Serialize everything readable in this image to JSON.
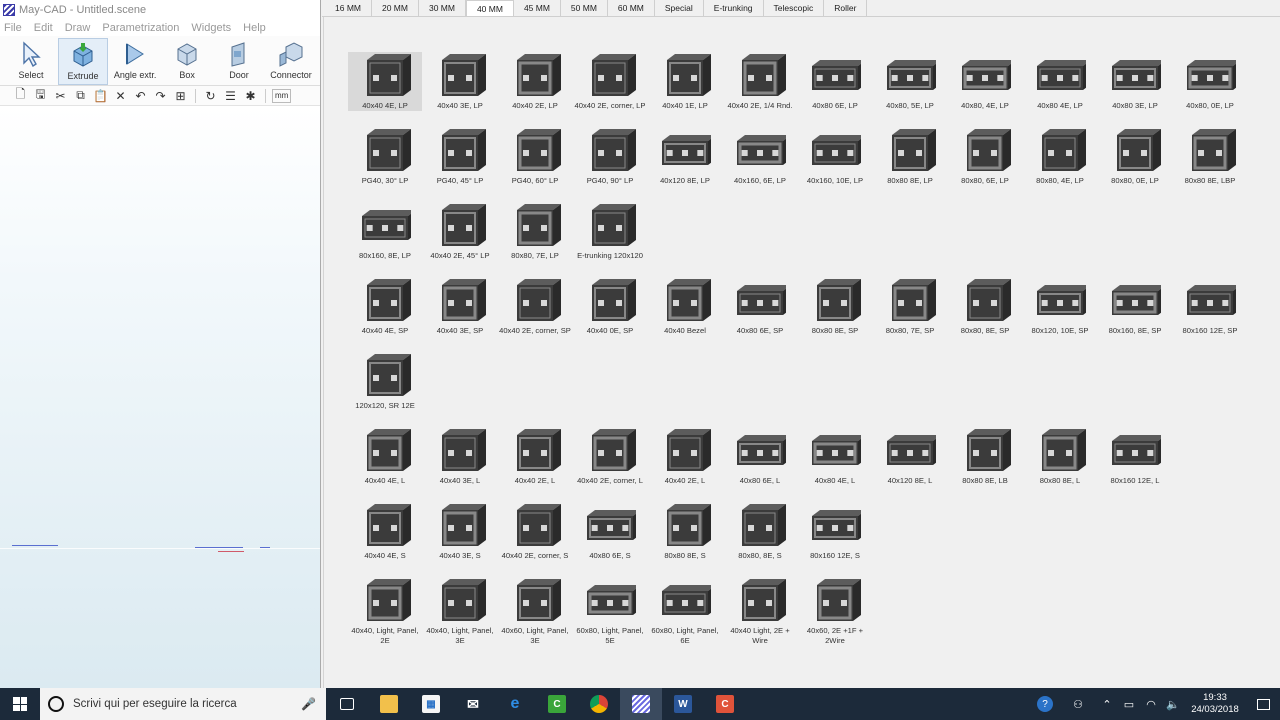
{
  "app": {
    "title": "May-CAD - Untitled.scene",
    "menu": [
      "File",
      "Edit",
      "Draw",
      "Parametrization",
      "Widgets",
      "Help"
    ],
    "ribbon": [
      {
        "label": "Select",
        "icon": "cursor-icon"
      },
      {
        "label": "Extrude",
        "icon": "extrude-icon",
        "active": true
      },
      {
        "label": "Angle extr.",
        "icon": "angle-extrude-icon"
      },
      {
        "label": "Box",
        "icon": "box-icon"
      },
      {
        "label": "Door",
        "icon": "door-icon"
      },
      {
        "label": "Connector",
        "icon": "connector-icon"
      }
    ],
    "toolbar": {
      "icons": [
        "new-file-icon",
        "save-icon",
        "cut-icon",
        "copy-icon",
        "paste-icon",
        "delete-icon",
        "undo-icon",
        "redo-icon",
        "grid-icon",
        "rotate-icon",
        "properties-icon",
        "settings-icon"
      ],
      "unit": "mm"
    }
  },
  "catalog": {
    "tabs": [
      "16 MM",
      "20 MM",
      "30 MM",
      "40 MM",
      "45 MM",
      "50 MM",
      "60 MM",
      "Special",
      "E-trunking",
      "Telescopic",
      "Roller"
    ],
    "active_tab": "40 MM",
    "sections": [
      [
        "40x40 4E, LP",
        "40x40 3E, LP",
        "40x40 2E, LP",
        "40x40 2E, corner, LP",
        "40x40 1E, LP",
        "40x40 2E, 1/4 Rnd.",
        "40x80 6E, LP",
        "40x80, 5E, LP",
        "40x80, 4E, LP",
        "40x80 4E, LP",
        "40x80 3E, LP",
        "40x80, 0E, LP",
        "PG40, 30° LP",
        "PG40, 45° LP",
        "PG40, 60° LP",
        "PG40, 90° LP",
        "40x120 8E, LP",
        "40x160, 6E, LP",
        "40x160, 10E, LP",
        "80x80 8E, LP",
        "80x80, 6E, LP",
        "80x80, 4E, LP",
        "80x80, 0E, LP",
        "80x80 8E, LBP",
        "80x160, 8E, LP",
        "40x40 2E, 45° LP",
        "80x80, 7E, LP",
        "E-trunking 120x120"
      ],
      [
        "40x40 4E, SP",
        "40x40 3E, SP",
        "40x40 2E, corner, SP",
        "40x40 0E, SP",
        "40x40 Bezel",
        "40x80 6E, SP",
        "80x80 8E, SP",
        "80x80, 7E, SP",
        "80x80, 8E, SP",
        "80x120, 10E, SP",
        "80x160, 8E, SP",
        "80x160 12E, SP",
        "120x120, SR 12E"
      ],
      [
        "40x40 4E, L",
        "40x40 3E, L",
        "40x40 2E, L",
        "40x40 2E, corner, L",
        "40x40 2E, L",
        "40x80 6E, L",
        "40x80 4E, L",
        "40x120 8E, L",
        "80x80 8E, LB",
        "80x80 8E, L",
        "80x160 12E, L",
        "40x40 4E, S",
        "40x40 3E, S",
        "40x40 2E, corner, S",
        "40x80 6E, S",
        "80x80 8E, S",
        "80x80, 8E, S",
        "80x160 12E, S",
        "40x40, Light, Panel, 2E",
        "40x40, Light, Panel, 3E",
        "40x60, Light, Panel, 3E",
        "60x80, Light, Panel, 5E",
        "60x80, Light, Panel, 6E",
        "40x40 Light, 2E + Wire",
        "40x60, 2E +1F + 2Wire"
      ]
    ],
    "selected_item": "40x40 4E, LP"
  },
  "taskbar": {
    "search_placeholder": "Scrivi qui per eseguire la ricerca",
    "apps": [
      "task-view-icon",
      "file-explorer-icon",
      "store-icon",
      "mail-icon",
      "edge-icon",
      "camtasia-icon",
      "chrome-icon",
      "maycad-icon",
      "word-icon",
      "recorder-icon"
    ],
    "time": "19:33",
    "date": "24/03/2018"
  }
}
